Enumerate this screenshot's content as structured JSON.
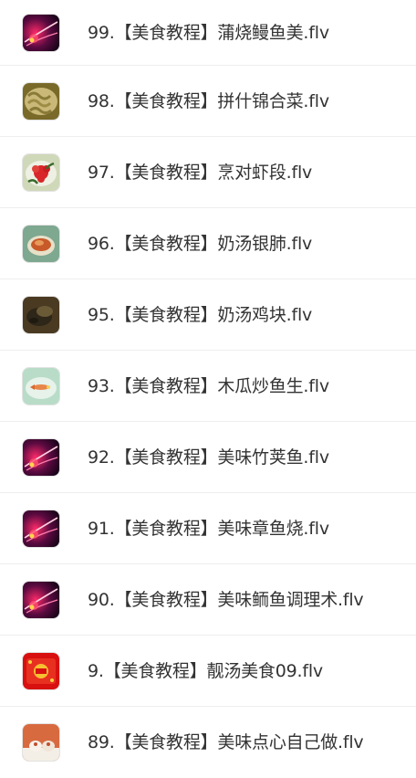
{
  "files": [
    {
      "name": "99.【美食教程】蒲烧鳗鱼美.flv",
      "thumb": "video-thumb-flare-icon"
    },
    {
      "name": "98.【美食教程】拼什锦合菜.flv",
      "thumb": "video-thumb-mixed-dish-icon"
    },
    {
      "name": "97.【美食教程】烹对虾段.flv",
      "thumb": "video-thumb-flower-plate-icon"
    },
    {
      "name": "96.【美食教程】奶汤银肺.flv",
      "thumb": "video-thumb-soup-bowl-icon"
    },
    {
      "name": "95.【美食教程】奶汤鸡块.flv",
      "thumb": "video-thumb-dark-dish-icon"
    },
    {
      "name": "93.【美食教程】木瓜炒鱼生.flv",
      "thumb": "video-thumb-fish-plate-icon"
    },
    {
      "name": "92.【美食教程】美味竹荚鱼.flv",
      "thumb": "video-thumb-flare-icon"
    },
    {
      "name": "91.【美食教程】美味章鱼烧.flv",
      "thumb": "video-thumb-flare-icon"
    },
    {
      "name": "90.【美食教程】美味鲕鱼调理术.flv",
      "thumb": "video-thumb-flare-icon"
    },
    {
      "name": "9.【美食教程】靓汤美食09.flv",
      "thumb": "video-thumb-red-poster-icon"
    },
    {
      "name": "89.【美食教程】美味点心自己做.flv",
      "thumb": "video-thumb-dessert-icon"
    }
  ]
}
